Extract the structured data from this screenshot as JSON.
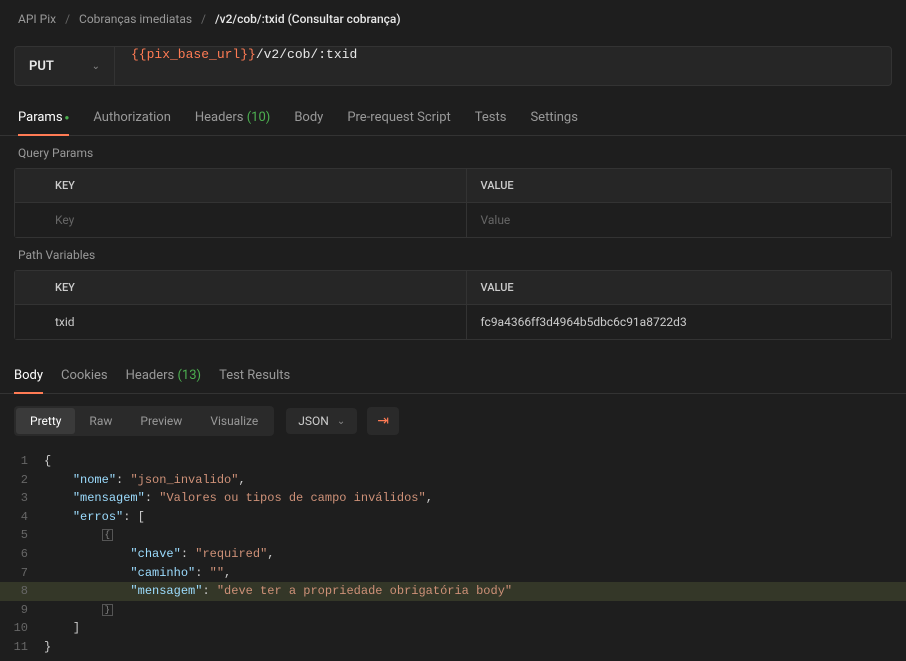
{
  "breadcrumb": {
    "parts": [
      "API Pix",
      "Cobranças imediatas"
    ],
    "current": "/v2/cob/:txid (Consultar cobrança)"
  },
  "request": {
    "method": "PUT",
    "url_variable": "{{pix_base_url}}",
    "url_path": "/v2/cob/:txid"
  },
  "request_tabs": {
    "params": "Params",
    "authorization": "Authorization",
    "headers": "Headers",
    "headers_count": "(10)",
    "body": "Body",
    "prerequest": "Pre-request Script",
    "tests": "Tests",
    "settings": "Settings"
  },
  "query_params": {
    "section_label": "Query Params",
    "key_header": "KEY",
    "value_header": "VALUE",
    "key_placeholder": "Key",
    "value_placeholder": "Value"
  },
  "path_variables": {
    "section_label": "Path Variables",
    "key_header": "KEY",
    "value_header": "VALUE",
    "rows": [
      {
        "key": "txid",
        "value": "fc9a4366ff3d4964b5dbc6c91a8722d3"
      }
    ]
  },
  "response_tabs": {
    "body": "Body",
    "cookies": "Cookies",
    "headers": "Headers",
    "headers_count": "(13)",
    "test_results": "Test Results"
  },
  "view_modes": {
    "pretty": "Pretty",
    "raw": "Raw",
    "preview": "Preview",
    "visualize": "Visualize"
  },
  "format_select": "JSON",
  "response_body": {
    "nome": "json_invalido",
    "mensagem": "Valores ou tipos de campo inválidos",
    "erros": [
      {
        "chave": "required",
        "caminho": "",
        "mensagem": "deve ter a propriedade obrigatória body"
      }
    ]
  },
  "code_lines": [
    "1",
    "2",
    "3",
    "4",
    "5",
    "6",
    "7",
    "8",
    "9",
    "10",
    "11"
  ]
}
